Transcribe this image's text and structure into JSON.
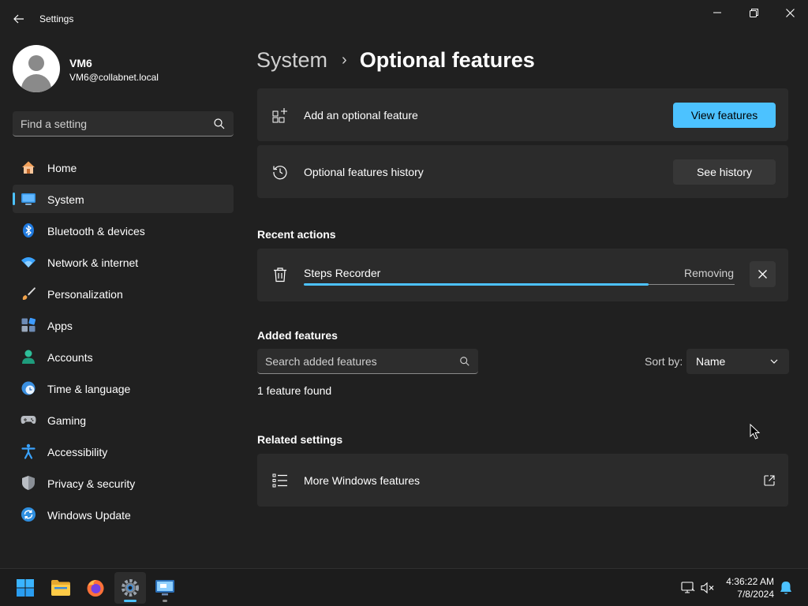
{
  "window": {
    "app_title": "Settings",
    "back_icon": "arrow-left-icon",
    "controls": [
      "minimize-icon",
      "maximize-icon",
      "close-icon"
    ]
  },
  "profile": {
    "name": "VM6",
    "email": "VM6@collabnet.local"
  },
  "search": {
    "placeholder": "Find a setting",
    "value": ""
  },
  "sidebar": {
    "items": [
      {
        "label": "Home",
        "icon": "home-icon",
        "selected": false
      },
      {
        "label": "System",
        "icon": "system-monitor-icon",
        "selected": true
      },
      {
        "label": "Bluetooth & devices",
        "icon": "bluetooth-icon",
        "selected": false
      },
      {
        "label": "Network & internet",
        "icon": "wifi-icon",
        "selected": false
      },
      {
        "label": "Personalization",
        "icon": "paintbrush-icon",
        "selected": false
      },
      {
        "label": "Apps",
        "icon": "apps-icon",
        "selected": false
      },
      {
        "label": "Accounts",
        "icon": "account-icon",
        "selected": false
      },
      {
        "label": "Time & language",
        "icon": "clock-globe-icon",
        "selected": false
      },
      {
        "label": "Gaming",
        "icon": "gamepad-icon",
        "selected": false
      },
      {
        "label": "Accessibility",
        "icon": "accessibility-icon",
        "selected": false
      },
      {
        "label": "Privacy & security",
        "icon": "shield-icon",
        "selected": false
      },
      {
        "label": "Windows Update",
        "icon": "update-icon",
        "selected": false
      }
    ]
  },
  "breadcrumb": {
    "parent": "System",
    "separator": "›",
    "current": "Optional features"
  },
  "cards": {
    "add_feature": {
      "label": "Add an optional feature",
      "button": "View features",
      "icon": "add-feature-icon"
    },
    "history": {
      "label": "Optional features history",
      "button": "See history",
      "icon": "history-icon"
    }
  },
  "recent_actions": {
    "title": "Recent actions",
    "items": [
      {
        "label": "Steps Recorder",
        "status": "Removing",
        "progress": 0.8,
        "icon": "trash-icon"
      }
    ]
  },
  "added_features": {
    "title": "Added features",
    "search_placeholder": "Search added features",
    "search_value": "",
    "sort_label": "Sort by:",
    "sort_value": "Name",
    "found_text": "1 feature found"
  },
  "related_settings": {
    "title": "Related settings",
    "items": [
      {
        "label": "More Windows features",
        "icon": "list-icon",
        "trailing_icon": "open-external-icon"
      }
    ]
  },
  "taskbar": {
    "apps": [
      "start-icon",
      "file-explorer-icon",
      "firefox-icon",
      "settings-gear-icon",
      "remote-desktop-icon"
    ],
    "tray": [
      "network-icon",
      "volume-muted-icon"
    ],
    "time": "4:36:22 AM",
    "date": "7/8/2024",
    "notification_icon": "notification-bell-icon"
  },
  "colors": {
    "accent": "#4cc2ff",
    "background": "#202020",
    "card": "#2b2b2b"
  }
}
